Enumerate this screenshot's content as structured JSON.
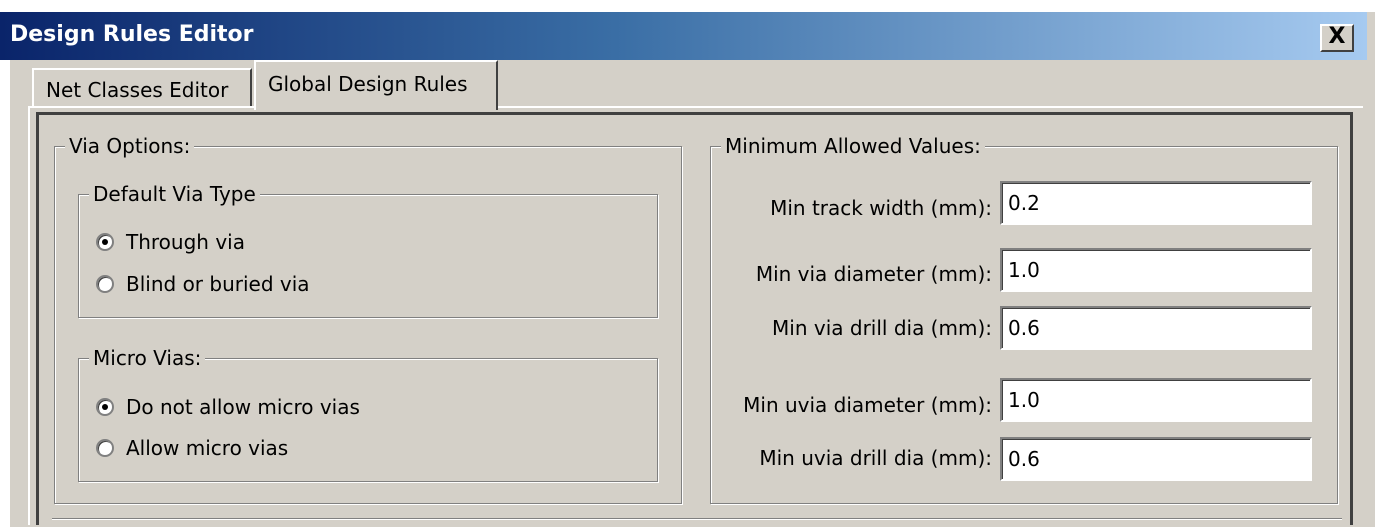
{
  "window": {
    "title": "Design Rules Editor",
    "close_label": "X"
  },
  "tabs": [
    {
      "label": "Net Classes Editor",
      "active": false
    },
    {
      "label": "Global Design Rules",
      "active": true
    }
  ],
  "via_options": {
    "legend": "Via Options:",
    "default_via_type": {
      "legend": "Default Via Type",
      "options": [
        {
          "label": "Through via",
          "checked": true
        },
        {
          "label": "Blind or buried via",
          "checked": false
        }
      ]
    },
    "micro_vias": {
      "legend": "Micro Vias:",
      "options": [
        {
          "label": "Do not allow micro vias",
          "checked": true
        },
        {
          "label": "Allow micro vias",
          "checked": false
        }
      ]
    }
  },
  "minimum_values": {
    "legend": "Minimum Allowed Values:",
    "fields": [
      {
        "label": "Min track width (mm):",
        "value": "0.2"
      },
      {
        "label": "Min via diameter (mm):",
        "value": "1.0"
      },
      {
        "label": "Min via drill dia (mm):",
        "value": "0.6"
      },
      {
        "label": "Min uvia diameter (mm):",
        "value": "1.0"
      },
      {
        "label": "Min uvia drill dia (mm):",
        "value": "0.6"
      }
    ]
  }
}
